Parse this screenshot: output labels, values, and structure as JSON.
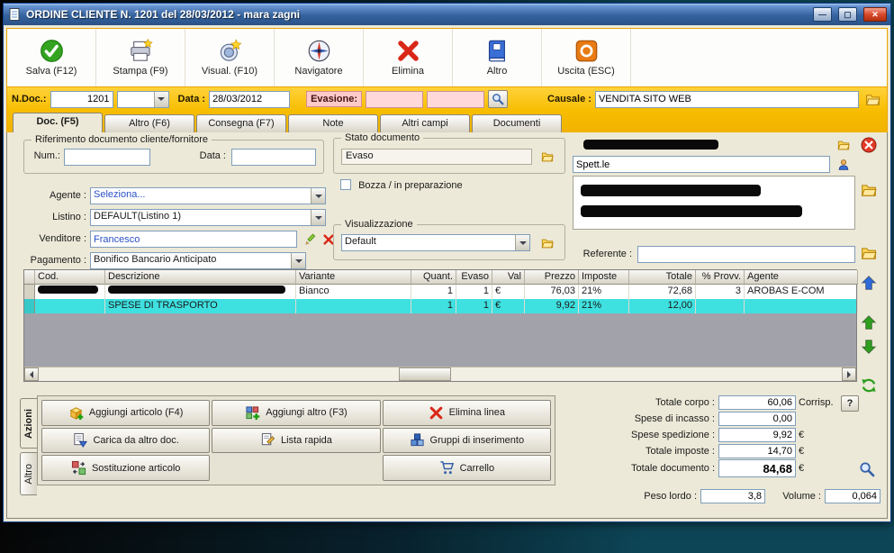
{
  "window": {
    "title": "ORDINE CLIENTE N. 1201  del 28/03/2012 - mara zagni"
  },
  "icons": {
    "minimize": "—",
    "maximize": "▢",
    "close": "✕"
  },
  "toolbar": {
    "buttons": [
      {
        "label": "Salva (F12)",
        "icon": "save-check-icon"
      },
      {
        "label": "Stampa (F9)",
        "icon": "printer-icon"
      },
      {
        "label": "Visual. (F10)",
        "icon": "preview-icon"
      },
      {
        "label": "Navigatore",
        "icon": "compass-icon"
      },
      {
        "label": "Elimina",
        "icon": "delete-x-icon"
      },
      {
        "label": "Altro",
        "icon": "book-icon"
      },
      {
        "label": "Uscita (ESC)",
        "icon": "exit-icon"
      }
    ]
  },
  "docbar": {
    "ndoc_label": "N.Doc.:",
    "ndoc_value": "1201",
    "type_value": "",
    "data_label": "Data :",
    "data_value": "28/03/2012",
    "evasione_label": "Evasione:",
    "evasione_from": "",
    "evasione_to": "",
    "causale_label": "Causale :",
    "causale_value": "VENDITA SITO WEB"
  },
  "tabs": [
    {
      "label": "Doc. (F5)"
    },
    {
      "label": "Altro (F6)"
    },
    {
      "label": "Consegna (F7)"
    },
    {
      "label": "Note"
    },
    {
      "label": "Altri campi"
    },
    {
      "label": "Documenti"
    }
  ],
  "form": {
    "riferimento_legend": "Riferimento documento cliente/fornitore",
    "num_label": "Num.:",
    "num_value": "",
    "rif_data_label": "Data :",
    "rif_data_value": "",
    "agente_label": "Agente :",
    "agente_value": "Seleziona...",
    "listino_label": "Listino :",
    "listino_value": "DEFAULT(Listino 1)",
    "venditore_label": "Venditore :",
    "venditore_value": "Francesco",
    "pagamento_label": "Pagamento :",
    "pagamento_value": "Bonifico Bancario Anticipato",
    "stato_legend": "Stato documento",
    "stato_value": "Evaso",
    "bozza_label": "Bozza / in preparazione",
    "visualizzazione_legend": "Visualizzazione",
    "visualizzazione_value": "Default",
    "spettle_value": "Spett.le",
    "referente_label": "Referente :",
    "referente_value": ""
  },
  "table": {
    "columns": [
      "",
      "Cod.",
      "Descrizione",
      "Variante",
      "Quant.",
      "Evaso",
      "Val",
      "Prezzo",
      "Imposte",
      "Totale",
      "% Provv.",
      "Agente"
    ],
    "rows": [
      {
        "cells": [
          "",
          "",
          "",
          "Bianco",
          "1",
          "1",
          "€",
          "76,03",
          "21%",
          "72,68",
          "3",
          "AROBAS E-COM"
        ]
      },
      {
        "cells": [
          "",
          "",
          "SPESE DI TRASPORTO",
          "",
          "1",
          "1",
          "€",
          "9,92",
          "21%",
          "12,00",
          "",
          ""
        ]
      }
    ]
  },
  "actions": {
    "tab_azioni": "Azioni",
    "tab_altro": "Altro",
    "buttons": [
      {
        "label": "Aggiungi articolo (F4)"
      },
      {
        "label": "Aggiungi altro (F3)"
      },
      {
        "label": "Elimina linea"
      },
      {
        "label": "Carica da altro doc."
      },
      {
        "label": "Lista rapida"
      },
      {
        "label": "Gruppi di inserimento"
      },
      {
        "label": "Sostituzione articolo"
      },
      {
        "label": "Carrello"
      }
    ]
  },
  "totals": {
    "corpo_label": "Totale corpo :",
    "corpo_value": "60,06",
    "corrisp_label": "Corrisp.",
    "help_label": "?",
    "incasso_label": "Spese di incasso :",
    "incasso_value": "0,00",
    "spedizione_label": "Spese spedizione :",
    "spedizione_value": "9,92",
    "imposte_label": "Totale imposte :",
    "imposte_value": "14,70",
    "documento_label": "Totale documento :",
    "documento_value": "84,68",
    "euro": "€",
    "peso_label": "Peso lordo :",
    "peso_value": "3,8",
    "volume_label": "Volume :",
    "volume_value": "0,064"
  },
  "colors": {
    "gold": "#f7bd00",
    "selected_row": "#3fe0e0",
    "evasione_pink": "#ffd9d9",
    "titlebar_blue": "#35639f"
  }
}
